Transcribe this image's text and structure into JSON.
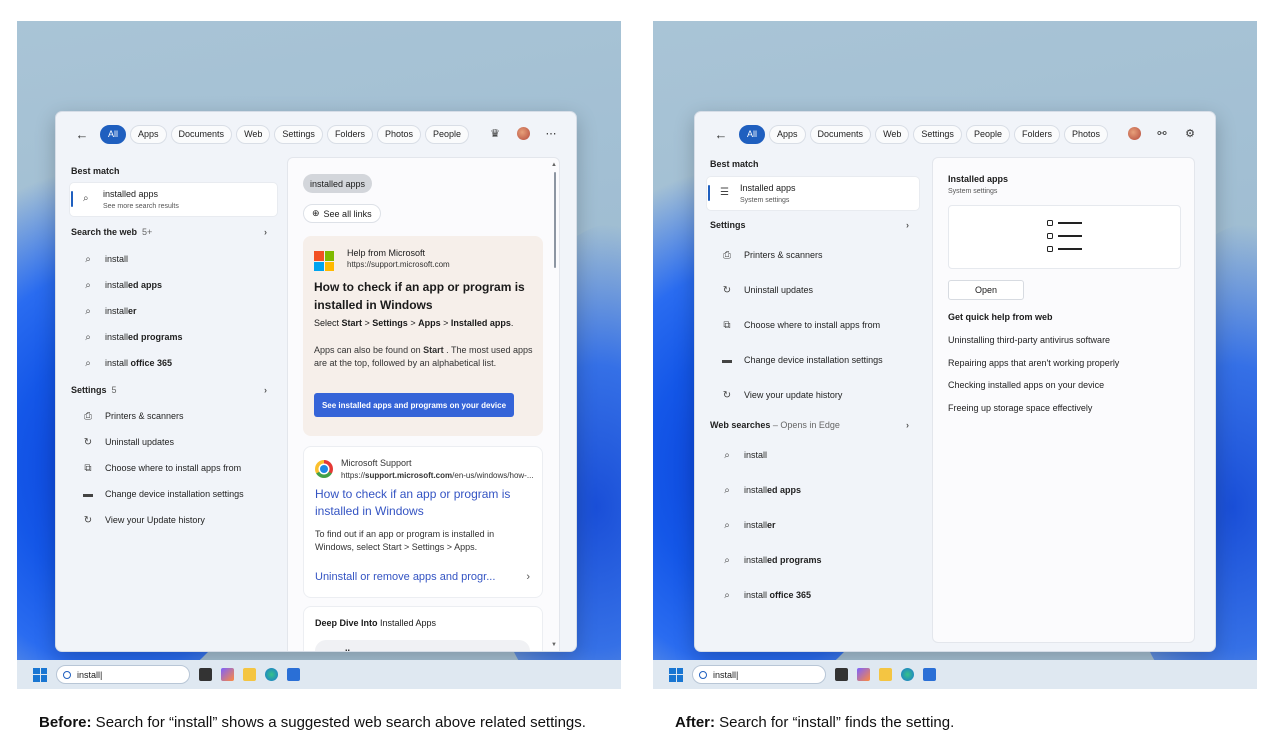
{
  "filters_before": [
    "All",
    "Apps",
    "Documents",
    "Web",
    "Settings",
    "Folders",
    "Photos",
    "People"
  ],
  "filters_after": [
    "All",
    "Apps",
    "Documents",
    "Web",
    "Settings",
    "People",
    "Folders",
    "Photos"
  ],
  "taskbar": {
    "search_text": "install|"
  },
  "before": {
    "best_match_header": "Best match",
    "best_match": {
      "title": "installed apps",
      "subtitle": "See more search results"
    },
    "web_header": "Search the web",
    "web_count": "5+",
    "web_items": [
      {
        "normal": "install",
        "bold": ""
      },
      {
        "normal": "install",
        "bold": "ed apps"
      },
      {
        "normal": "install",
        "bold": "er"
      },
      {
        "normal": "install",
        "bold": "ed programs"
      },
      {
        "normal": "install",
        "bold": " office 365"
      }
    ],
    "settings_header": "Settings",
    "settings_count": "5",
    "settings_items": [
      {
        "label": "Printers & scanners",
        "icon": "printer-icon"
      },
      {
        "label": "Uninstall updates",
        "icon": "refresh-icon"
      },
      {
        "label": "Choose where to install apps from",
        "icon": "app-install-icon"
      },
      {
        "label": "Change device installation settings",
        "icon": "device-icon"
      },
      {
        "label": "View your Update history",
        "icon": "refresh-icon"
      }
    ],
    "query_pill": "installed apps",
    "see_all_links": "See all links",
    "ms_card": {
      "source": "Help from Microsoft",
      "url": "https://support.microsoft.com",
      "heading": "How to check if an app or program is installed in Windows",
      "select_prefix": "Select ",
      "start": "Start",
      "sep": " > ",
      "settings": "Settings",
      "apps": "Apps",
      "installed_apps": "Installed apps",
      "period": ".",
      "body_prefix": "Apps can also be found on ",
      "body_start": "Start",
      "body_suffix": " . The most used apps are at the top, followed by an alphabetical list.",
      "button": "See installed apps and programs on your device"
    },
    "support_card": {
      "source": "Microsoft Support",
      "url_prefix": "https://",
      "url_bold": "support.microsoft.com",
      "url_suffix": "/en-us/windows/how-...",
      "heading": "How to check if an app or program is installed in Windows",
      "body": "To find out if an app or program is installed in Windows, select Start > Settings > Apps.",
      "link": "Uninstall or remove apps and progr..."
    },
    "deep_card": {
      "bold": "Deep Dive Into",
      "rest": " Installed Apps",
      "search": "all my apps"
    }
  },
  "after": {
    "best_match_header": "Best match",
    "best_match": {
      "title": "Installed apps",
      "subtitle": "System settings"
    },
    "settings_header": "Settings",
    "settings_items": [
      {
        "label": "Printers & scanners",
        "icon": "printer-icon"
      },
      {
        "label": "Uninstall updates",
        "icon": "refresh-icon"
      },
      {
        "label": "Choose where to install apps from",
        "icon": "app-install-icon"
      },
      {
        "label": "Change device installation settings",
        "icon": "device-icon"
      },
      {
        "label": "View your update history",
        "icon": "refresh-icon"
      }
    ],
    "web_header": "Web searches",
    "web_suffix": " – Opens in Edge",
    "web_items": [
      {
        "normal": "install",
        "bold": ""
      },
      {
        "normal": "install",
        "bold": "ed apps"
      },
      {
        "normal": "install",
        "bold": "er"
      },
      {
        "normal": "install",
        "bold": "ed programs"
      },
      {
        "normal": "install",
        "bold": " office 365"
      }
    ],
    "detail": {
      "title": "Installed apps",
      "subtitle": "System settings",
      "open": "Open",
      "help_header": "Get quick help from web",
      "help_links": [
        "Uninstalling third-party antivirus software",
        "Repairing apps that aren't working properly",
        "Checking installed apps on your device",
        "Freeing up storage space effectively"
      ]
    }
  },
  "captions": {
    "before_bold": "Before:",
    "before_text": " Search for “install” shows a suggested web search above related settings.",
    "after_bold": "After:",
    "after_text": " Search for “install” finds the setting."
  },
  "colors": {
    "accent": "#1f5fbf",
    "link": "#3454c3",
    "ms_button": "#3564d8"
  }
}
